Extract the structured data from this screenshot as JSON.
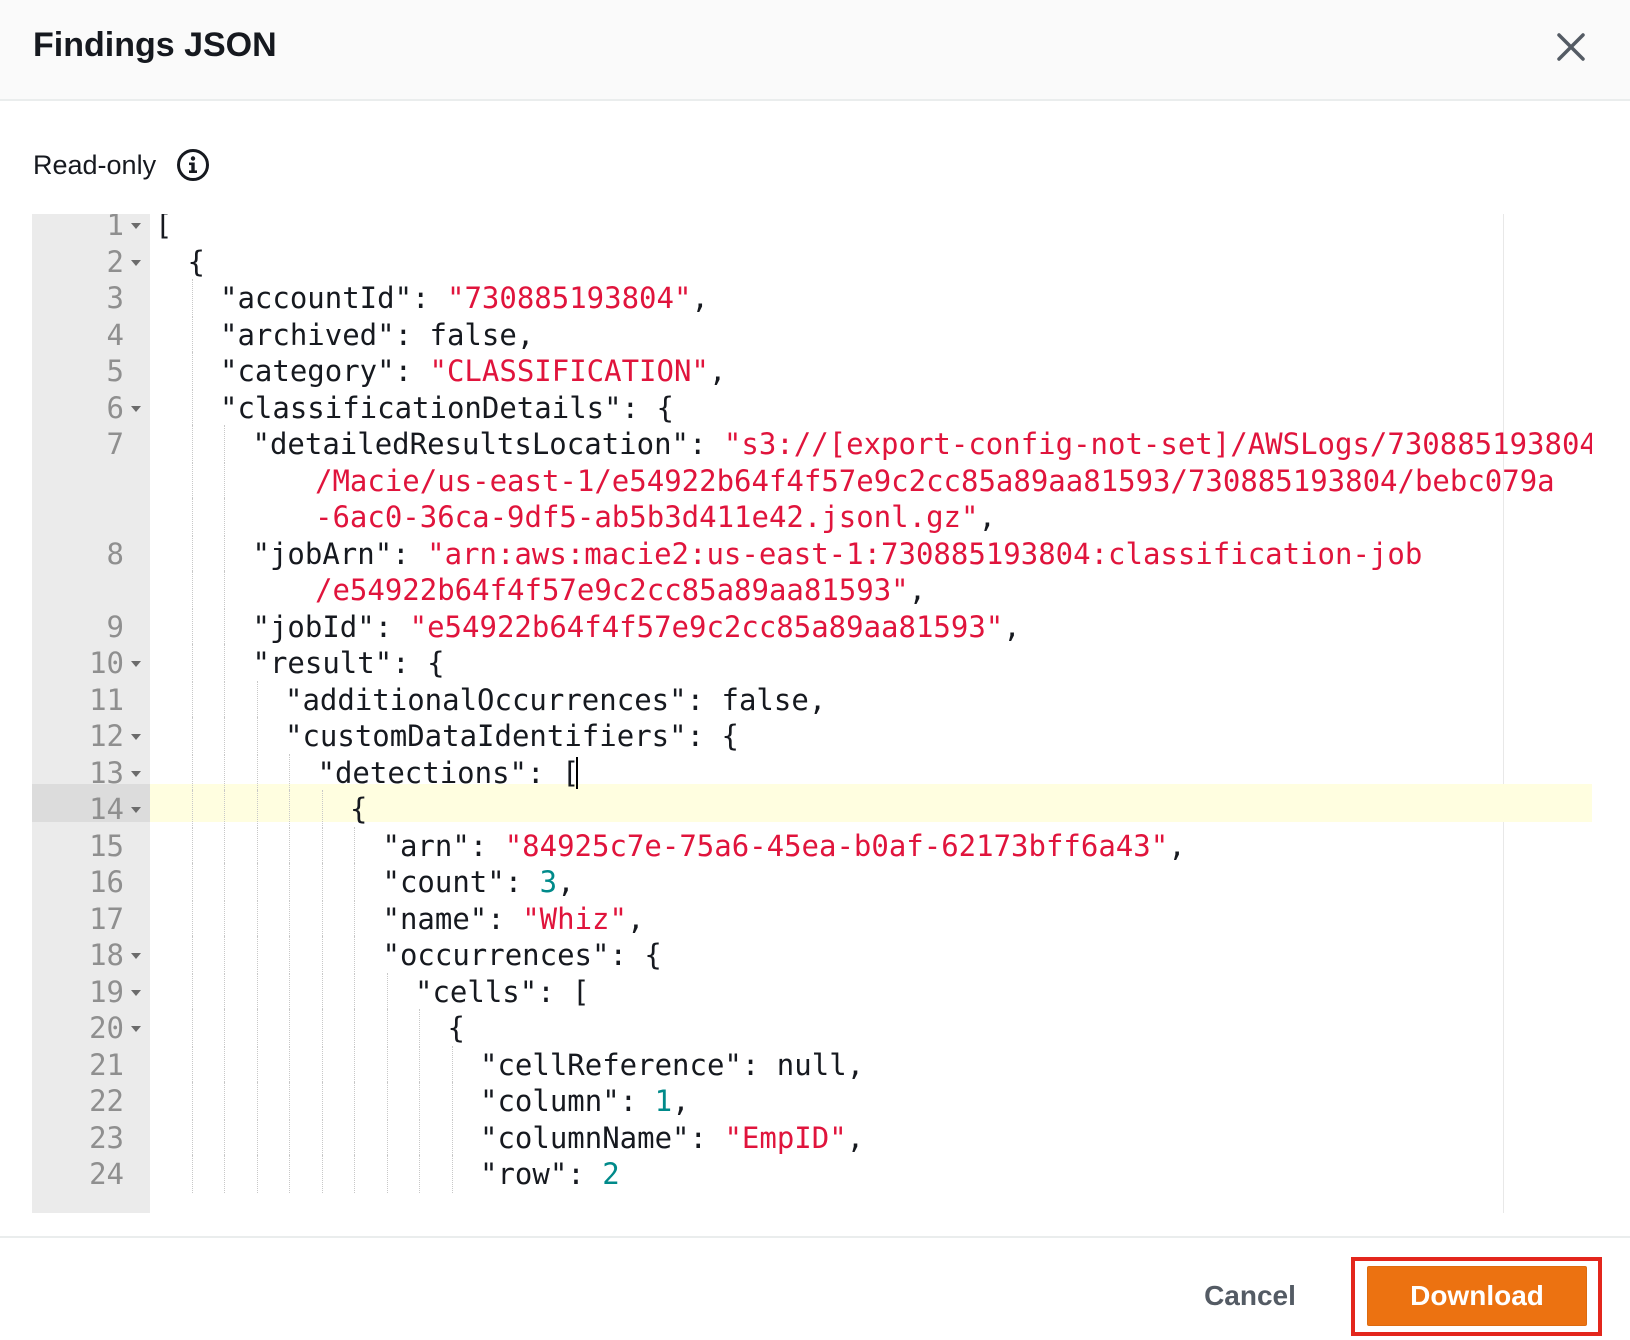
{
  "modal": {
    "title": "Findings JSON",
    "close_icon": "close-x-icon"
  },
  "editor": {
    "mode_label": "Read-only",
    "info_icon": "info-circle-icon",
    "active_line": "13",
    "lines": [
      {
        "n": "1",
        "fold": true,
        "indent": 0,
        "tokens": [
          [
            "p",
            "["
          ]
        ]
      },
      {
        "n": "2",
        "fold": true,
        "indent": 1,
        "tokens": [
          [
            "p",
            "{"
          ]
        ]
      },
      {
        "n": "3",
        "fold": false,
        "indent": 2,
        "tokens": [
          [
            "p",
            "\"accountId\": "
          ],
          [
            "s",
            "\"730885193804\""
          ],
          [
            "p",
            ","
          ]
        ]
      },
      {
        "n": "4",
        "fold": false,
        "indent": 2,
        "tokens": [
          [
            "p",
            "\"archived\": false,"
          ]
        ]
      },
      {
        "n": "5",
        "fold": false,
        "indent": 2,
        "tokens": [
          [
            "p",
            "\"category\": "
          ],
          [
            "s",
            "\"CLASSIFICATION\""
          ],
          [
            "p",
            ","
          ]
        ]
      },
      {
        "n": "6",
        "fold": true,
        "indent": 2,
        "tokens": [
          [
            "p",
            "\"classificationDetails\": {"
          ]
        ]
      },
      {
        "n": "7",
        "fold": false,
        "indent": 3,
        "tokens": [
          [
            "p",
            "\"detailedResultsLocation\": "
          ],
          [
            "s",
            "\"s3://[export-config-not-set]/AWSLogs/730885193804"
          ]
        ]
      },
      {
        "n": "",
        "fold": false,
        "indent": 3,
        "wrap": true,
        "tokens": [
          [
            "s",
            "/Macie/us-east-1/e54922b64f4f57e9c2cc85a89aa81593/730885193804/bebc079a"
          ]
        ]
      },
      {
        "n": "",
        "fold": false,
        "indent": 3,
        "wrap": true,
        "tokens": [
          [
            "s",
            "-6ac0-36ca-9df5-ab5b3d411e42.jsonl.gz\""
          ],
          [
            "p",
            ","
          ]
        ]
      },
      {
        "n": "8",
        "fold": false,
        "indent": 3,
        "tokens": [
          [
            "p",
            "\"jobArn\": "
          ],
          [
            "s",
            "\"arn:aws:macie2:us-east-1:730885193804:classification-job"
          ]
        ]
      },
      {
        "n": "",
        "fold": false,
        "indent": 3,
        "wrap": true,
        "tokens": [
          [
            "s",
            "/e54922b64f4f57e9c2cc85a89aa81593\""
          ],
          [
            "p",
            ","
          ]
        ]
      },
      {
        "n": "9",
        "fold": false,
        "indent": 3,
        "tokens": [
          [
            "p",
            "\"jobId\": "
          ],
          [
            "s",
            "\"e54922b64f4f57e9c2cc85a89aa81593\""
          ],
          [
            "p",
            ","
          ]
        ]
      },
      {
        "n": "10",
        "fold": true,
        "indent": 3,
        "tokens": [
          [
            "p",
            "\"result\": {"
          ]
        ]
      },
      {
        "n": "11",
        "fold": false,
        "indent": 4,
        "tokens": [
          [
            "p",
            "\"additionalOccurrences\": false,"
          ]
        ]
      },
      {
        "n": "12",
        "fold": true,
        "indent": 4,
        "tokens": [
          [
            "p",
            "\"customDataIdentifiers\": {"
          ]
        ]
      },
      {
        "n": "13",
        "fold": true,
        "indent": 5,
        "cursor": true,
        "tokens": [
          [
            "p",
            "\"detections\": ["
          ]
        ]
      },
      {
        "n": "14",
        "fold": true,
        "indent": 6,
        "tokens": [
          [
            "p",
            "{"
          ]
        ]
      },
      {
        "n": "15",
        "fold": false,
        "indent": 7,
        "tokens": [
          [
            "p",
            "\"arn\": "
          ],
          [
            "s",
            "\"84925c7e-75a6-45ea-b0af-62173bff6a43\""
          ],
          [
            "p",
            ","
          ]
        ]
      },
      {
        "n": "16",
        "fold": false,
        "indent": 7,
        "tokens": [
          [
            "p",
            "\"count\": "
          ],
          [
            "n",
            "3"
          ],
          [
            "p",
            ","
          ]
        ]
      },
      {
        "n": "17",
        "fold": false,
        "indent": 7,
        "tokens": [
          [
            "p",
            "\"name\": "
          ],
          [
            "s",
            "\"Whiz\""
          ],
          [
            "p",
            ","
          ]
        ]
      },
      {
        "n": "18",
        "fold": true,
        "indent": 7,
        "tokens": [
          [
            "p",
            "\"occurrences\": {"
          ]
        ]
      },
      {
        "n": "19",
        "fold": true,
        "indent": 8,
        "tokens": [
          [
            "p",
            "\"cells\": ["
          ]
        ]
      },
      {
        "n": "20",
        "fold": true,
        "indent": 9,
        "tokens": [
          [
            "p",
            "{"
          ]
        ]
      },
      {
        "n": "21",
        "fold": false,
        "indent": 10,
        "tokens": [
          [
            "p",
            "\"cellReference\": null,"
          ]
        ]
      },
      {
        "n": "22",
        "fold": false,
        "indent": 10,
        "tokens": [
          [
            "p",
            "\"column\": "
          ],
          [
            "n",
            "1"
          ],
          [
            "p",
            ","
          ]
        ]
      },
      {
        "n": "23",
        "fold": false,
        "indent": 10,
        "tokens": [
          [
            "p",
            "\"columnName\": "
          ],
          [
            "s",
            "\"EmpID\""
          ],
          [
            "p",
            ","
          ]
        ]
      },
      {
        "n": "24",
        "fold": false,
        "indent": 10,
        "tokens": [
          [
            "p",
            "\"row\": "
          ],
          [
            "n",
            "2"
          ]
        ]
      }
    ]
  },
  "footer": {
    "cancel_label": "Cancel",
    "download_label": "Download"
  },
  "colors": {
    "string": "#e0143c",
    "number": "#008a8a",
    "primary_button": "#ec7211",
    "highlight_frame": "#e3261c",
    "active_line_bg": "#fffee0"
  }
}
